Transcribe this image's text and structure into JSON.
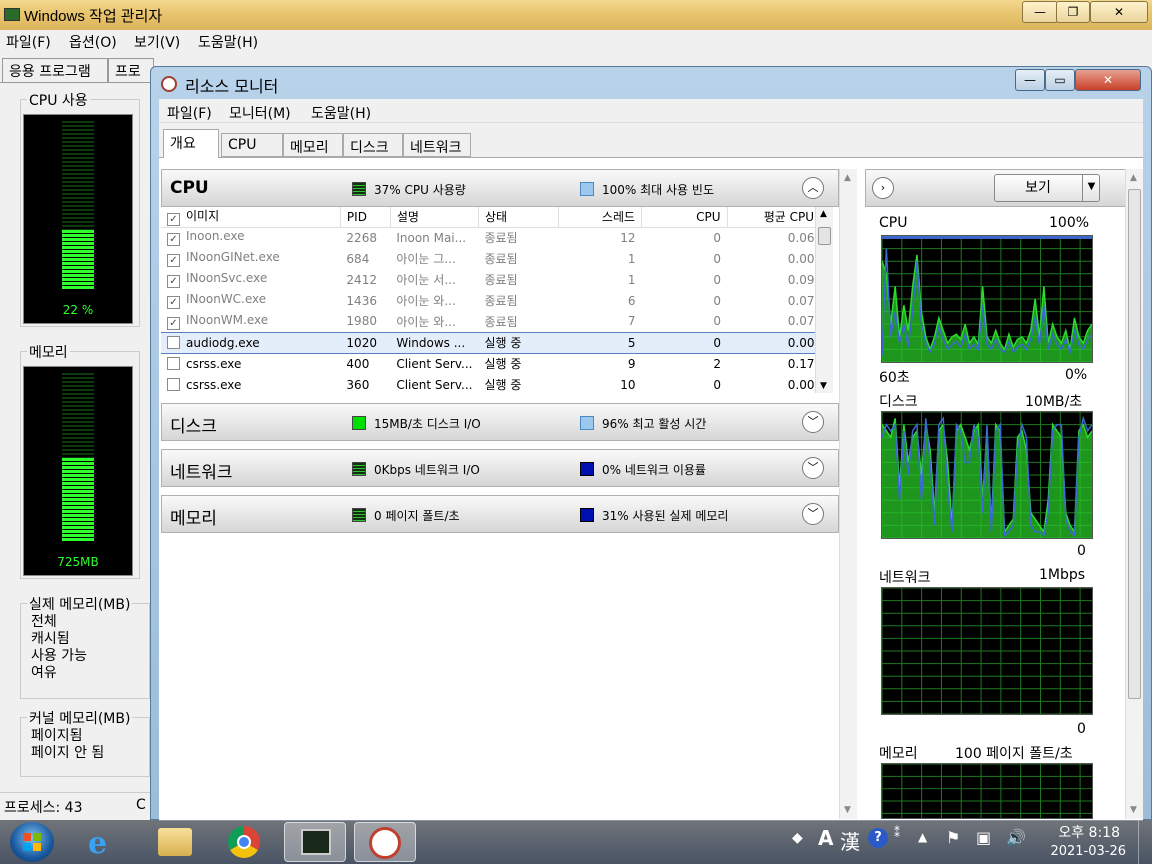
{
  "taskmgr": {
    "title": "Windows 작업 관리자",
    "menu": [
      "파일(F)",
      "옵션(O)",
      "보기(V)",
      "도움말(H)"
    ],
    "tabs": [
      "응용 프로그램",
      "프로"
    ],
    "cpu_label": "CPU 사용",
    "cpu_value": "22 %",
    "cpu_percent": 22,
    "mem_label": "메모리",
    "mem_value": "725MB",
    "mem_percent": 31,
    "physical_title": "실제 메모리(MB)",
    "physical_items": [
      "전체",
      "캐시됨",
      "사용 가능",
      "여유"
    ],
    "kernel_title": "커널 메모리(MB)",
    "kernel_items": [
      "페이지됨",
      "페이지 안 됨"
    ],
    "status": "프로세스: 43",
    "status_extra": "C"
  },
  "resmon": {
    "title": "리소스 모니터",
    "menu": [
      "파일(F)",
      "모니터(M)",
      "도움말(H)"
    ],
    "tabs": [
      "개요",
      "CPU",
      "메모리",
      "디스크",
      "네트워크"
    ],
    "cpu_section": {
      "name": "CPU",
      "stat1": "37% CPU 사용량",
      "stat2": "100% 최대 사용 빈도",
      "columns": [
        "이미지",
        "PID",
        "설명",
        "상태",
        "스레드",
        "CPU",
        "평균 CPU"
      ],
      "rows": [
        {
          "checked": true,
          "image": "Inoon.exe",
          "pid": "2268",
          "desc": "Inoon Mai...",
          "status": "종료됨",
          "threads": "12",
          "cpu": "0",
          "avg": "0.06",
          "state": "term"
        },
        {
          "checked": true,
          "image": "INoonGINet.exe",
          "pid": "684",
          "desc": "아이눈 그...",
          "status": "종료됨",
          "threads": "1",
          "cpu": "0",
          "avg": "0.00",
          "state": "term"
        },
        {
          "checked": true,
          "image": "INoonSvc.exe",
          "pid": "2412",
          "desc": "아이눈 서...",
          "status": "종료됨",
          "threads": "1",
          "cpu": "0",
          "avg": "0.09",
          "state": "term"
        },
        {
          "checked": true,
          "image": "INoonWC.exe",
          "pid": "1436",
          "desc": "아이눈 와...",
          "status": "종료됨",
          "threads": "6",
          "cpu": "0",
          "avg": "0.07",
          "state": "term"
        },
        {
          "checked": true,
          "image": "INoonWM.exe",
          "pid": "1980",
          "desc": "아이눈 와...",
          "status": "종료됨",
          "threads": "7",
          "cpu": "0",
          "avg": "0.07",
          "state": "term"
        },
        {
          "checked": false,
          "image": "audiodg.exe",
          "pid": "1020",
          "desc": "Windows ...",
          "status": "실행 중",
          "threads": "5",
          "cpu": "0",
          "avg": "0.00",
          "state": "sel"
        },
        {
          "checked": false,
          "image": "csrss.exe",
          "pid": "400",
          "desc": "Client Serv...",
          "status": "실행 중",
          "threads": "9",
          "cpu": "2",
          "avg": "0.17",
          "state": "run"
        },
        {
          "checked": false,
          "image": "csrss.exe",
          "pid": "360",
          "desc": "Client Serv...",
          "status": "실행 중",
          "threads": "10",
          "cpu": "0",
          "avg": "0.00",
          "state": "run"
        }
      ]
    },
    "disk_section": {
      "name": "디스크",
      "stat1": "15MB/초 디스크 I/O",
      "stat2": "96% 최고 활성 시간"
    },
    "network_section": {
      "name": "네트워크",
      "stat1": "0Kbps 네트워크 I/O",
      "stat2": "0% 네트워크 이용률"
    },
    "memory_section": {
      "name": "메모리",
      "stat1": "0 페이지 폴트/초",
      "stat2": "31% 사용된 실제 메모리"
    },
    "view_button": "보기",
    "graphs": {
      "cpu": {
        "label": "CPU",
        "max": "100%",
        "time": "60초",
        "min": "0%"
      },
      "disk": {
        "label": "디스크",
        "max": "10MB/초",
        "min": "0"
      },
      "network": {
        "label": "네트워크",
        "max": "1Mbps",
        "min": "0"
      },
      "memory": {
        "label": "메모리",
        "max": "100 페이지 폴트/초"
      }
    },
    "cpu_series": [
      80,
      70,
      30,
      60,
      20,
      45,
      25,
      60,
      85,
      40,
      20,
      10,
      20,
      35,
      25,
      15,
      20,
      22,
      18,
      30,
      15,
      20,
      14,
      60,
      20,
      15,
      25,
      15,
      10,
      22,
      12,
      18,
      20,
      15,
      25,
      50,
      20,
      60,
      15,
      30,
      20,
      15,
      25,
      10,
      35,
      20,
      15,
      25,
      30
    ],
    "cpu_series2": [
      5,
      90,
      20,
      40,
      15,
      30,
      12,
      40,
      80,
      30,
      15,
      8,
      15,
      28,
      18,
      10,
      14,
      16,
      12,
      22,
      10,
      14,
      10,
      45,
      14,
      10,
      18,
      10,
      8,
      16,
      8,
      12,
      14,
      10,
      18,
      36,
      14,
      45,
      10,
      22,
      14,
      10,
      18,
      8,
      25,
      14,
      10,
      18,
      22
    ],
    "disk_series": [
      90,
      85,
      80,
      95,
      40,
      90,
      60,
      80,
      85,
      50,
      90,
      70,
      20,
      85,
      90,
      60,
      10,
      85,
      90,
      80,
      70,
      85,
      90,
      30,
      85,
      10,
      90,
      85,
      5,
      10,
      15,
      80,
      85,
      70,
      20,
      15,
      10,
      5,
      30,
      90,
      85,
      80,
      20,
      10,
      5,
      85,
      90,
      80,
      85
    ],
    "disk_series2": [
      80,
      90,
      85,
      90,
      30,
      85,
      50,
      85,
      90,
      30,
      95,
      60,
      10,
      90,
      95,
      40,
      5,
      90,
      85,
      60,
      60,
      90,
      80,
      20,
      90,
      5,
      85,
      90,
      2,
      5,
      10,
      70,
      90,
      80,
      10,
      5,
      5,
      2,
      20,
      85,
      90,
      90,
      15,
      5,
      2,
      80,
      95,
      85,
      90
    ]
  },
  "taskbar": {
    "ime_lang": "A",
    "ime_hanja": "漢",
    "time": "오후 8:18",
    "date": "2021-03-26"
  }
}
